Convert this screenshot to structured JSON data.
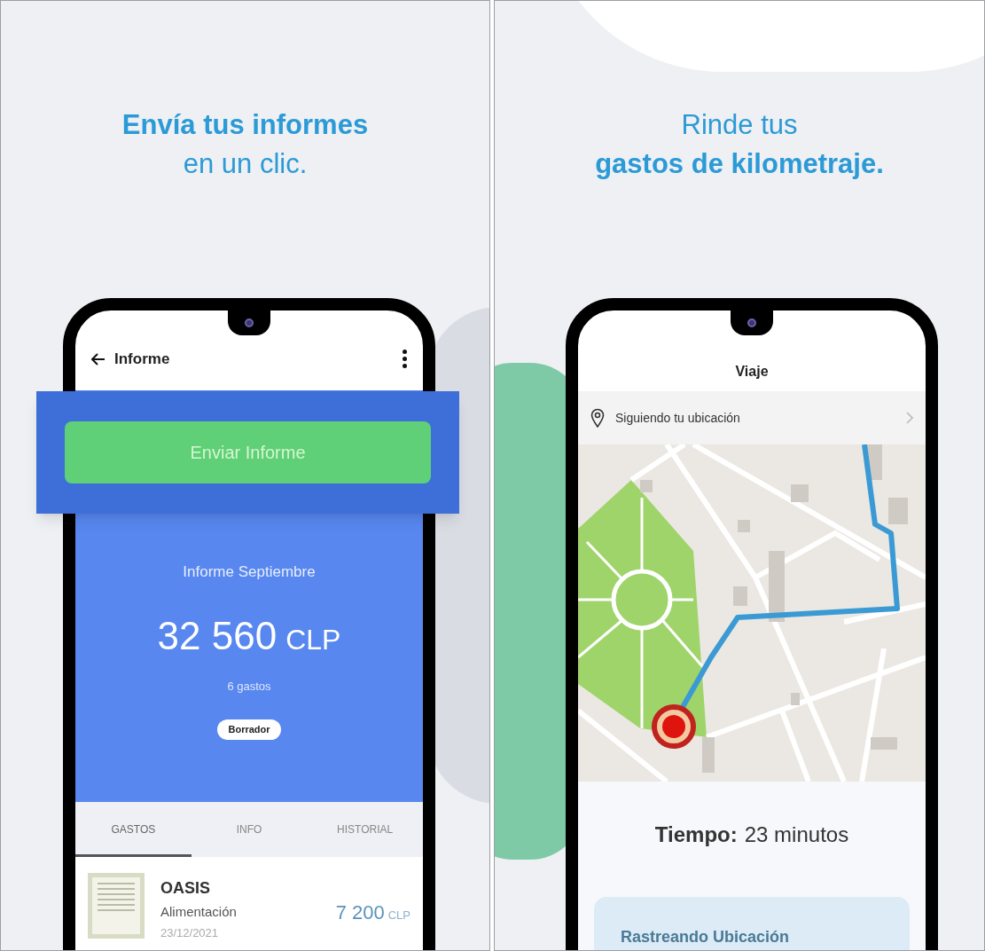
{
  "report_promo": {
    "headline": [
      {
        "text": "Envía tus informes",
        "bold": true
      },
      {
        "text": "en un clic.",
        "bold": false
      }
    ],
    "title": "Informe",
    "send_button": "Enviar Informe",
    "report_name": "Informe Septiembre",
    "total_amount": "32 560",
    "total_currency": "CLP",
    "expense_count": "6 gastos",
    "status_badge": "Borrador",
    "tabs": [
      {
        "label": "GASTOS",
        "selected": true
      },
      {
        "label": "INFO",
        "selected": false
      },
      {
        "label": "HISTORIAL",
        "selected": false
      }
    ],
    "expenses": [
      {
        "merchant": "OASIS",
        "category": "Alimentación",
        "date": "23/12/2021",
        "amount": "7 200",
        "currency": "CLP"
      }
    ]
  },
  "trip_promo": {
    "headline": [
      {
        "text": "Rinde tus",
        "bold": false
      },
      {
        "text": "gastos de kilometraje.",
        "bold": true
      }
    ],
    "title": "Viaje",
    "location_row": "Siguiendo tu ubicación",
    "time_label": "Tiempo:",
    "time_value": "23 minutos",
    "tracking_card": "Rastreando Ubicación"
  }
}
